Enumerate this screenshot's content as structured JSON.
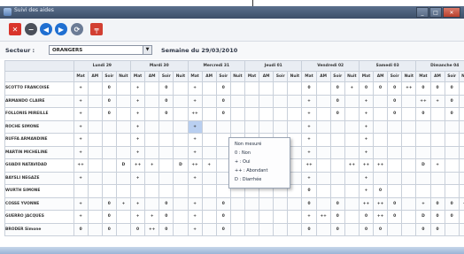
{
  "window": {
    "title": "Suivi des aides"
  },
  "toolbar": {
    "buttons": [
      {
        "name": "close-icon",
        "glyph": "✕",
        "color": "#d9342b"
      },
      {
        "name": "circle-minus-icon",
        "glyph": "−",
        "color": "#4a4f59"
      },
      {
        "name": "back-arrow-icon",
        "glyph": "◀",
        "color": "#1f6fd1"
      },
      {
        "name": "forward-arrow-icon",
        "glyph": "▶",
        "color": "#1f6fd1"
      },
      {
        "name": "refresh-icon",
        "glyph": "⟳",
        "color": "#6b7b95"
      },
      {
        "name": "tool-icon",
        "glyph": "╤",
        "color": "#d23f32"
      }
    ]
  },
  "filter": {
    "sector_label": "Secteur :",
    "sector_value": "ORANGERS",
    "week_label": "Semaine du 29/03/2010"
  },
  "grid": {
    "days": [
      "Lundi 29",
      "Mardi 30",
      "Mercredi 31",
      "Jeudi 01",
      "Vendredi 02",
      "Samedi 03",
      "Dimanche 04"
    ],
    "slots": [
      "Mat",
      "AM",
      "Soir",
      "Nuit"
    ],
    "rows": [
      {
        "name": "SCOTTO FRANCOISE",
        "cells": [
          "+",
          "",
          "0",
          "",
          "+",
          "",
          "0",
          "",
          "+",
          "",
          "0",
          "",
          "",
          "",
          "",
          "",
          "0",
          "",
          "0",
          "+",
          "0",
          "0",
          "0",
          "++",
          "0",
          "0",
          "0",
          ""
        ]
      },
      {
        "name": "ARMANDO CLAIRE",
        "cells": [
          "+",
          "",
          "0",
          "",
          "+",
          "",
          "0",
          "",
          "+",
          "",
          "0",
          "",
          "",
          "",
          "",
          "",
          "+",
          "",
          "0",
          "",
          "+",
          "",
          "0",
          "",
          "++",
          "+",
          "0",
          ""
        ]
      },
      {
        "name": "FOLLONIS MIREILLE",
        "cells": [
          "+",
          "",
          "0",
          "",
          "+",
          "",
          "0",
          "",
          "++",
          "",
          "0",
          "",
          "",
          "",
          "",
          "",
          "+",
          "",
          "0",
          "",
          "+",
          "",
          "0",
          "",
          "0",
          "",
          "0",
          ""
        ]
      },
      {
        "name": "ROCHE SIMONE",
        "cells": [
          "+",
          "",
          "",
          "",
          "+",
          "",
          "",
          "",
          "+",
          "",
          "",
          "",
          "",
          "",
          "",
          "",
          "+",
          "",
          "",
          "",
          "+",
          "",
          "",
          "",
          "",
          "",
          "",
          ""
        ]
      },
      {
        "name": "RUFFA ARMANDINE",
        "cells": [
          "+",
          "",
          "",
          "",
          "+",
          "",
          "",
          "",
          "+",
          "",
          "",
          "",
          "",
          "",
          "",
          "",
          "+",
          "",
          "",
          "",
          "+",
          "",
          "",
          "",
          "",
          "",
          "",
          ""
        ]
      },
      {
        "name": "MARTIN MICHELINE",
        "cells": [
          "+",
          "",
          "",
          "",
          "+",
          "",
          "",
          "",
          "+",
          "",
          "",
          "",
          "",
          "",
          "",
          "",
          "+",
          "",
          "",
          "",
          "+",
          "",
          "",
          "",
          "",
          "",
          "",
          ""
        ]
      },
      {
        "name": "GUADII NATAVIDAD",
        "cells": [
          "++",
          "",
          "",
          "D",
          "++",
          "+",
          "",
          "D",
          "++",
          "+",
          "",
          "",
          "",
          "",
          "",
          "",
          "++",
          "",
          "",
          "++",
          "++",
          "++",
          "",
          "",
          "D",
          "+",
          "",
          "D"
        ]
      },
      {
        "name": "BAYSLI NEGAZE",
        "cells": [
          "+",
          "",
          "",
          "",
          "+",
          "",
          "",
          "",
          "+",
          "",
          "",
          "",
          "",
          "",
          "",
          "",
          "+",
          "",
          "",
          "",
          "+",
          "",
          "",
          "",
          "",
          "",
          "",
          ""
        ]
      },
      {
        "name": "WURTH SIMONE",
        "cells": [
          "",
          "",
          "",
          "",
          "",
          "",
          "",
          "",
          "",
          "",
          "",
          "",
          "",
          "",
          "",
          "",
          "0",
          "",
          "",
          "",
          "+",
          "0",
          "",
          "",
          "",
          "",
          "",
          ""
        ]
      },
      {
        "name": "COSSE YVONNE",
        "cells": [
          "+",
          "",
          "0",
          "+",
          "+",
          "",
          "0",
          "",
          "+",
          "",
          "0",
          "",
          "",
          "",
          "",
          "",
          "0",
          "",
          "0",
          "",
          "++",
          "++",
          "0",
          "",
          "+",
          "0",
          "0",
          "++"
        ]
      },
      {
        "name": "GUERRO JACQUES",
        "cells": [
          "+",
          "",
          "0",
          "",
          "+",
          "+",
          "0",
          "",
          "+",
          "",
          "0",
          "",
          "",
          "",
          "",
          "",
          "+",
          "++",
          "0",
          "",
          "0",
          "++",
          "0",
          "",
          "D",
          "0",
          "0",
          ""
        ]
      },
      {
        "name": "BRODER Simone",
        "cells": [
          "0",
          "",
          "0",
          "",
          "0",
          "++",
          "0",
          "",
          "+",
          "",
          "0",
          "",
          "",
          "",
          "",
          "",
          "0",
          "",
          "0",
          "",
          "0",
          "0",
          "",
          "",
          "0",
          "0",
          "",
          ""
        ]
      }
    ],
    "active_cell": {
      "row": 3,
      "col": 8
    }
  },
  "context_menu": {
    "items": [
      "Non mesuré",
      "0 : Non",
      "+ : Oui",
      "++ : Abondant",
      "D : Diarrhée"
    ]
  },
  "colors": {
    "alert": "#d02c2c",
    "active_cell": "#b9cff0"
  }
}
